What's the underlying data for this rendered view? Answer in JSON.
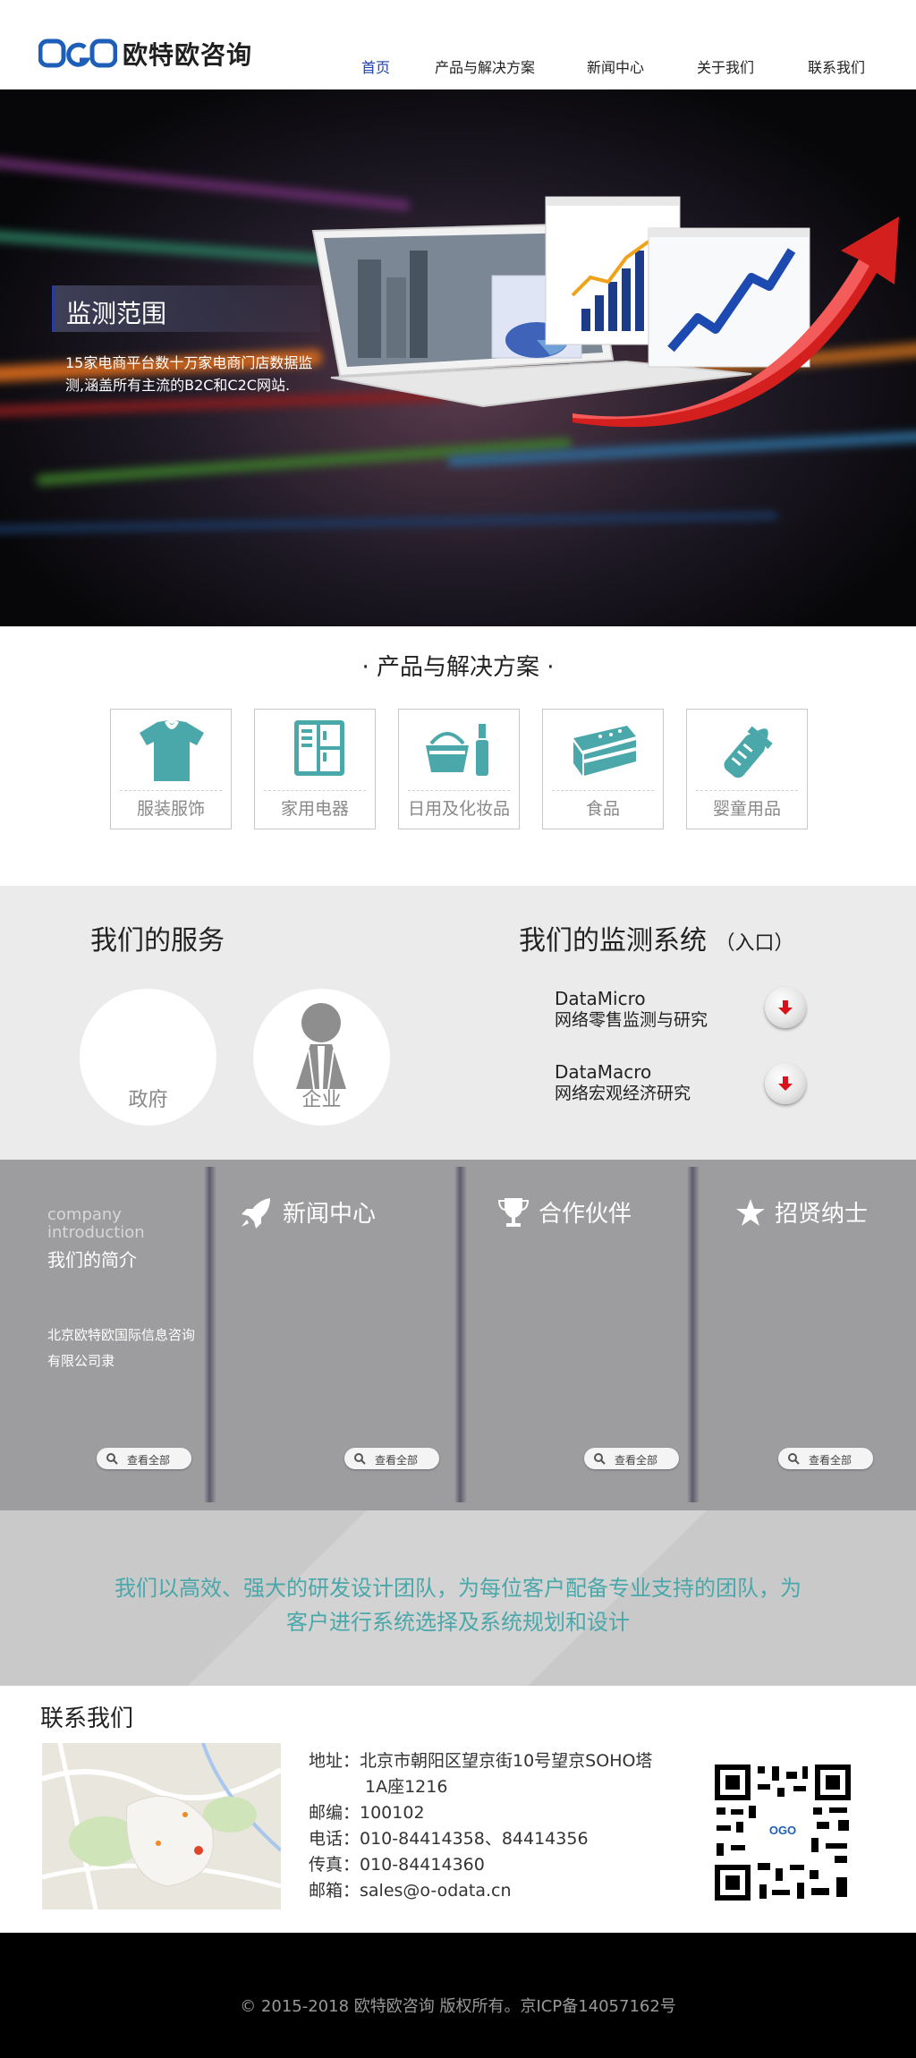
{
  "header": {
    "logo_text": "欧特欧咨询",
    "logo_mark_text": "OGO",
    "nav": [
      "首页",
      "产品与解决方案",
      "新闻中心",
      "关于我们",
      "联系我们"
    ],
    "active_nav": "首页"
  },
  "banner": {
    "heading": "监测范围",
    "description": "15家电商平台数十万家电商门店数据监测,涵盖所有主流的B2C和C2C网站."
  },
  "products": {
    "title": "· 产品与解决方案 ·",
    "items": [
      {
        "label": "服装服饰",
        "icon": "shirt-icon"
      },
      {
        "label": "家用电器",
        "icon": "fridge-icon"
      },
      {
        "label": "日用及化妆品",
        "icon": "basket-cosmetics-icon"
      },
      {
        "label": "食品",
        "icon": "cake-icon"
      },
      {
        "label": "婴童用品",
        "icon": "baby-bottle-icon"
      }
    ]
  },
  "services": {
    "title": "我们的服务",
    "items": [
      {
        "label": "政府",
        "icon": "government-building-icon"
      },
      {
        "label": "企业",
        "icon": "person-icon"
      }
    ]
  },
  "monitor": {
    "title": "我们的监测系统",
    "subtitle": "（入口）",
    "systems": [
      {
        "name": "DataMicro",
        "desc": "网络零售监测与研究"
      },
      {
        "name": "DataMacro",
        "desc": "网络宏观经济研究"
      }
    ]
  },
  "info": {
    "intro_en_1": "company",
    "intro_en_2": "introduction",
    "intro_cn": "我们的简介",
    "intro_body": "北京欧特欧国际信息咨询有限公司隶",
    "news_title": "新闻中心",
    "partners_title": "合作伙伴",
    "jobs_title": "招贤纳士",
    "more_label": "查看全部"
  },
  "slogan": "我们以高效、强大的研发设计团队，为每位客户配备专业支持的团队，为客户进行系统选择及系统规划和设计",
  "contact": {
    "title": "联系我们",
    "address_1": "地址：北京市朝阳区望京街10号望京SOHO塔",
    "address_2": "1A座1216",
    "postcode": "邮编：100102",
    "phone": "电话：010-84414358、84414356",
    "fax": "传真：010-84414360",
    "email": "邮箱：sales@o-odata.cn"
  },
  "footer": {
    "copyright": "© 2015-2018 欧特欧咨询 版权所有。京ICP备14057162号"
  },
  "colors": {
    "nav_active": "#1c3fae",
    "accent_teal": "#4aa7aa",
    "product_icon": "#4aa7aa",
    "section_gray": "#9d9c9e",
    "down_arrow": "#d8111a"
  }
}
